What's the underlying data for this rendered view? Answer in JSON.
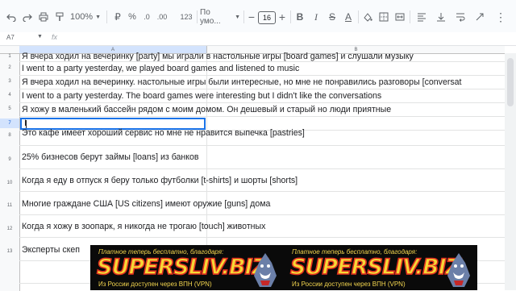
{
  "toolbar": {
    "zoom": "100%",
    "number_format": "123",
    "font": "По умо...",
    "font_size": "16",
    "bold": "B",
    "italic": "I",
    "strikethrough": "S",
    "text_color": "A"
  },
  "formula_bar": {
    "cell_ref": "A7",
    "fx": "fx"
  },
  "columns": [
    {
      "label": "A"
    },
    {
      "label": "B"
    }
  ],
  "rows": [
    {
      "num": "1",
      "text": "Я вчера ходил на вечеринку [party] мы играли в настольные игры [board games] и слушали музыку"
    },
    {
      "num": "2",
      "text": "I went to a party yesterday, we played board games and listened to music"
    },
    {
      "num": "3",
      "text": "Я вчера ходил на вечеринку. настольные игры были интересные, но мне не понравились разговоры [conversat"
    },
    {
      "num": "4",
      "text": "I went to a party yesterday. The board games were interesting but I didn't like the conversations"
    },
    {
      "num": "5",
      "text": "Я хожу в маленький бассейн рядом с моим домом. Он дешевый и старый но люди приятные"
    },
    {
      "num": "7",
      "text": "I"
    },
    {
      "num": "8",
      "text": "Это кафе имеет хороший сервис но мне не нравится выпечка [pastries]"
    },
    {
      "num": "9",
      "text": "25% бизнесов берут займы [loans] из банков"
    },
    {
      "num": "10",
      "text": "Когда я еду в отпуск я беру только футболки [t-shirts] и шорты [shorts]"
    },
    {
      "num": "11",
      "text": "Многие граждане США [US citizens] имеют оружие [guns] дома"
    },
    {
      "num": "12",
      "text": "Когда я хожу в зоопарк, я никогда не трогаю [touch] животных"
    },
    {
      "num": "13",
      "text": "Эксперты скеп"
    }
  ],
  "banner": {
    "top_text": "Платное теперь бесплатно, благодаря:",
    "brand": "SUPERSLIV.BIZ",
    "bottom_text": "Из России доступен через ВПН (VPN)"
  }
}
